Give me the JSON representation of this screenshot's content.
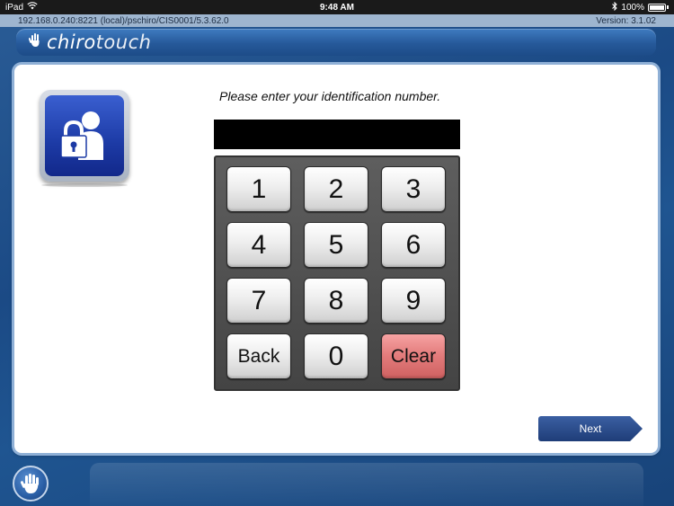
{
  "status_bar": {
    "carrier": "iPad",
    "time": "9:48 AM",
    "battery": "100%"
  },
  "info_bar": {
    "connection": "192.168.0.240:8221 (local)/pschiro/CIS0001/5.3.62.0",
    "version": "Version: 3.1.02"
  },
  "header": {
    "logo_part1": "chiro",
    "logo_part2": "touch"
  },
  "main": {
    "prompt": "Please enter your identification number.",
    "id_value": "",
    "keys": [
      "1",
      "2",
      "3",
      "4",
      "5",
      "6",
      "7",
      "8",
      "9",
      "Back",
      "0",
      "Clear"
    ],
    "next_label": "Next"
  },
  "colors": {
    "clear_key": "#e27a7a",
    "next_button": "#1f3d78",
    "background": "#1b4a85"
  },
  "icons": {
    "lock_user": "lock-user-icon",
    "hand": "hand-icon",
    "wifi": "wifi-icon",
    "bluetooth": "bluetooth-icon"
  }
}
